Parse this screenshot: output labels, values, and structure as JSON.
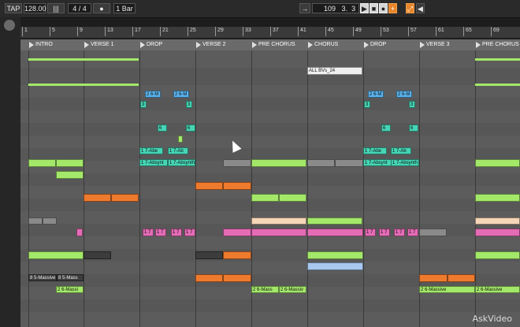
{
  "transport": {
    "tap": "TAP",
    "tempo": "128.00",
    "time_sig_num": "4",
    "time_sig_den": "4",
    "quantize": "1 Bar",
    "pos_bar": "109",
    "pos_beat": "3",
    "pos_sixteenth": "3"
  },
  "ruler": {
    "bars": [
      "1",
      "5",
      "9",
      "13",
      "17",
      "21",
      "25",
      "29",
      "33",
      "37",
      "41",
      "45",
      "49",
      "53",
      "57",
      "61",
      "65",
      "69"
    ]
  },
  "locators": [
    "INTRO",
    "VERSE 1",
    "DROP",
    "VERSE 2",
    "PRE CHORUS",
    "CHORUS",
    "DROP",
    "VERSE 3",
    "PRE CHORUS"
  ],
  "clips": {
    "bvs": "ALL BVs_24",
    "c2_6m": "2 6-M",
    "c3": "3",
    "c6": "6",
    "c1_7abe": "1 7-Abe",
    "c1_7ab": "1 7-Ab",
    "c1_7absynt": "1 7-Absynt",
    "c1_7absynth": "1 7-Absynth",
    "c1_7": "1 7",
    "c8_5massive": "8 5-Massive",
    "c8_5mass": "8 5-Mass",
    "c2_6massive": "2 6-Massive",
    "c2_6massi": "2 6-Massi",
    "c2_6massiv": "2 6-Massiv",
    "c2_6mass": "2 6-Mass",
    "c2_": "2"
  },
  "watermark": "AskVideo",
  "colors": {
    "green": "#a4e86a",
    "orange": "#ee7a2e",
    "pink": "#e46cb5",
    "cyan": "#46d4b4",
    "blue": "#5ab2ec"
  }
}
